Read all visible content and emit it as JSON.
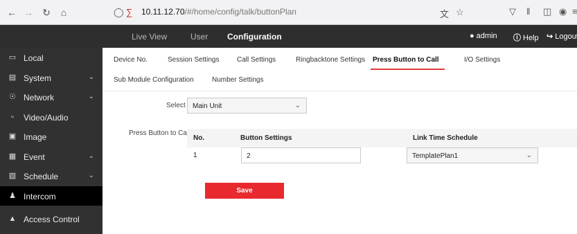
{
  "browser": {
    "url_host": "10.11.12.70",
    "url_path": "/#/home/config/talk/buttonPlan",
    "icons": [
      "back-icon",
      "forward-icon",
      "reload-icon",
      "home-icon",
      "shield-icon",
      "lock-icon",
      "translate-icon",
      "star-icon",
      "pocket-icon",
      "library-icon",
      "sidebar-icon",
      "account-icon",
      "extensions-icon",
      "menu-icon"
    ]
  },
  "topnav": {
    "items": [
      "Live View",
      "User",
      "Configuration"
    ],
    "user": "admin",
    "help": "Help",
    "logout": "Logout"
  },
  "sidebar": {
    "items": [
      {
        "label": "Local",
        "icon": "monitor-icon",
        "expandable": false
      },
      {
        "label": "System",
        "icon": "window-icon",
        "expandable": true
      },
      {
        "label": "Network",
        "icon": "globe-icon",
        "expandable": true
      },
      {
        "label": "Video/Audio",
        "icon": "camera-icon",
        "expandable": false
      },
      {
        "label": "Image",
        "icon": "image-icon",
        "expandable": false
      },
      {
        "label": "Event",
        "icon": "clipboard-icon",
        "expandable": true
      },
      {
        "label": "Schedule",
        "icon": "calendar-icon",
        "expandable": true
      },
      {
        "label": "Intercom",
        "icon": "person-icon",
        "expandable": false
      },
      {
        "label": "Access Control",
        "icon": "lock-icon",
        "expandable": false
      }
    ],
    "active_index": 7
  },
  "tabs": {
    "row1": [
      "Device No.",
      "Session Settings",
      "Call Settings",
      "Ringbacktone Settings",
      "Press Button to Call",
      "I/O Settings"
    ],
    "row2": [
      "Sub Module Configuration",
      "Number Settings"
    ],
    "active": "Press Button to Call"
  },
  "form": {
    "select_label": "Select",
    "select_value": "Main Unit",
    "section_label": "Press Button to Call",
    "columns": [
      "No.",
      "Button Settings",
      "Link Time Schedule"
    ],
    "rows": [
      {
        "no": "1",
        "button_setting": "2",
        "schedule": "TemplatePlan1"
      }
    ],
    "save_label": "Save"
  },
  "colors": {
    "accent": "#e8292d",
    "nav_bg": "#2e2e2e",
    "sidebar_bg": "#313131",
    "sidebar_active": "#000000"
  }
}
